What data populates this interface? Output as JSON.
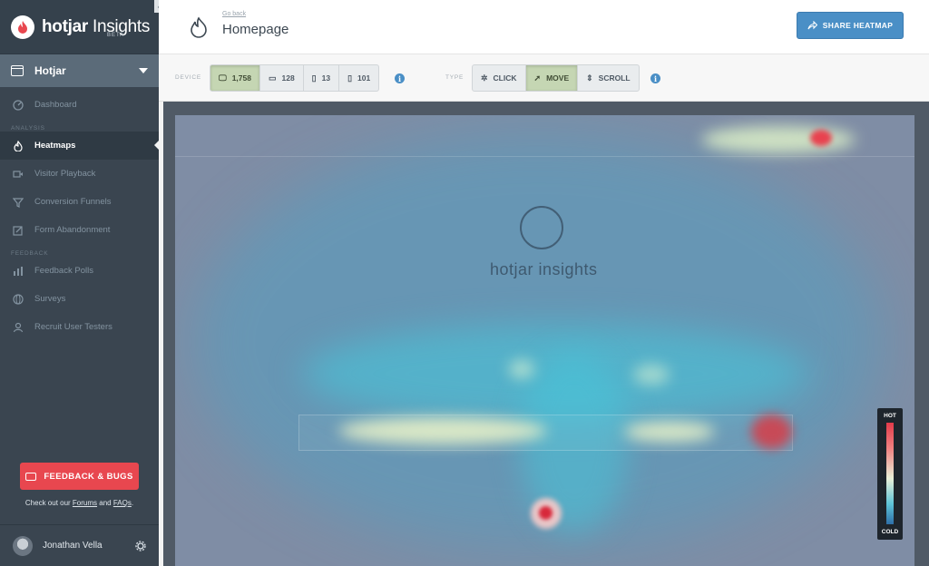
{
  "sidebar": {
    "logo": {
      "brand": "hotjar",
      "product": "Insights",
      "badge": "BETA"
    },
    "site": {
      "name": "Hotjar"
    },
    "items": [
      {
        "label": "Dashboard",
        "icon": "dashboard-icon"
      },
      {
        "label": "Heatmaps",
        "icon": "flame-icon"
      },
      {
        "label": "Visitor Playback",
        "icon": "video-camera-icon"
      },
      {
        "label": "Conversion Funnels",
        "icon": "funnel-icon"
      },
      {
        "label": "Form Abandonment",
        "icon": "form-edit-icon"
      },
      {
        "label": "Feedback Polls",
        "icon": "bar-chart-icon"
      },
      {
        "label": "Surveys",
        "icon": "globe-icon"
      },
      {
        "label": "Recruit User Testers",
        "icon": "user-icon"
      }
    ],
    "sections": {
      "analysis": "ANALYSIS",
      "feedback": "FEEDBACK"
    },
    "feedback_button": "FEEDBACK & BUGS",
    "footer": {
      "prefix": "Check out our ",
      "forums": "Forums",
      "and": " and ",
      "faqs": "FAQs",
      "suffix": "."
    },
    "user": {
      "name": "Jonathan Vella"
    }
  },
  "header": {
    "go_back": "Go back",
    "title": "Homepage",
    "share_button": "SHARE HEATMAP"
  },
  "toolbar": {
    "device_label": "DEVICE",
    "type_label": "TYPE",
    "devices": [
      {
        "count": "1,758",
        "icon": "desktop-icon",
        "active": true
      },
      {
        "count": "128",
        "icon": "monitor-icon",
        "active": false
      },
      {
        "count": "13",
        "icon": "tablet-icon",
        "active": false
      },
      {
        "count": "101",
        "icon": "phone-icon",
        "active": false
      }
    ],
    "types": [
      {
        "label": "CLICK",
        "icon": "click-icon",
        "active": false
      },
      {
        "label": "MOVE",
        "icon": "cursor-icon",
        "active": true
      },
      {
        "label": "SCROLL",
        "icon": "scroll-icon",
        "active": false
      }
    ]
  },
  "heatmap": {
    "page_brand": "hotjar insights",
    "legend": {
      "hot": "HOT",
      "cold": "COLD"
    }
  },
  "colors": {
    "sidebar_bg": "#3a4550",
    "accent_blue": "#4a8fc6",
    "feedback_red": "#e8474f",
    "active_segment": "#c5d6b3"
  }
}
